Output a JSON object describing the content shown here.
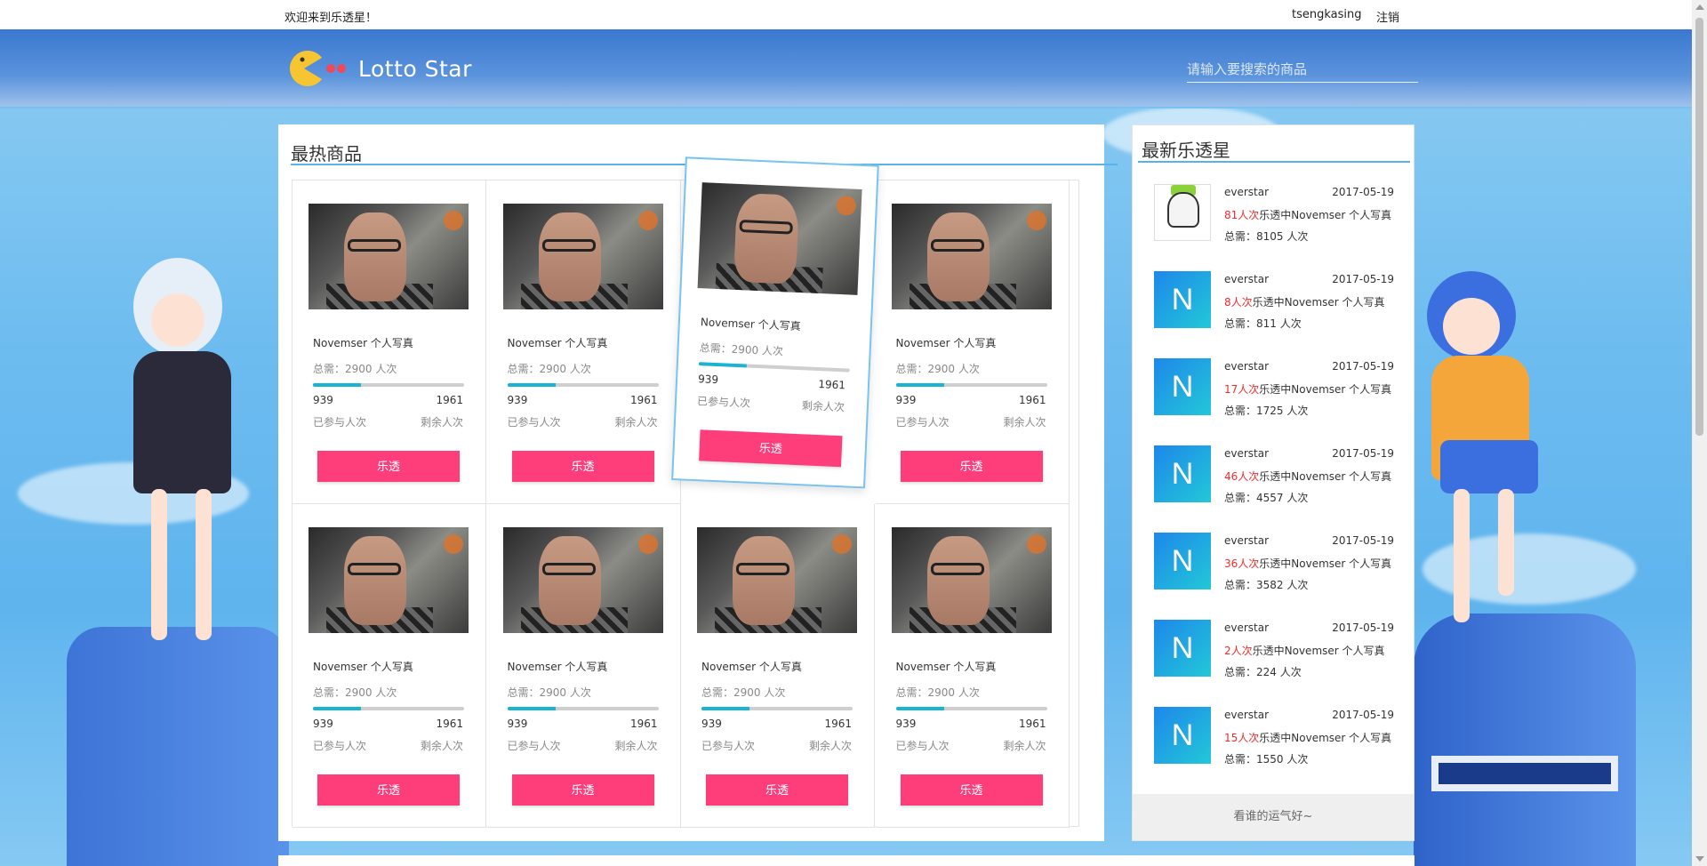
{
  "topbar": {
    "welcome": "欢迎来到乐透星！",
    "username": "tsengkasing",
    "logout": "注销"
  },
  "header": {
    "logo_text": "Lotto Star",
    "search_placeholder": "请输入要搜索的商品"
  },
  "hot": {
    "title": "最热商品",
    "products": [
      {
        "name": "Novemser 个人写真",
        "need": "总需：2900 人次",
        "joined": "939",
        "remain": "1961",
        "joined_label": "已参与人次",
        "remain_label": "剩余人次",
        "button": "乐透",
        "progress": 0.32
      },
      {
        "name": "Novemser 个人写真",
        "need": "总需：2900 人次",
        "joined": "939",
        "remain": "1961",
        "joined_label": "已参与人次",
        "remain_label": "剩余人次",
        "button": "乐透",
        "progress": 0.32
      },
      {
        "name": "Novemser 个人写真",
        "need": "总需：2900 人次",
        "joined": "939",
        "remain": "1961",
        "joined_label": "已参与人次",
        "remain_label": "剩余人次",
        "button": "乐透",
        "progress": 0.32
      },
      {
        "name": "Novemser 个人写真",
        "need": "总需：2900 人次",
        "joined": "939",
        "remain": "1961",
        "joined_label": "已参与人次",
        "remain_label": "剩余人次",
        "button": "乐透",
        "progress": 0.32
      },
      {
        "name": "Novemser 个人写真",
        "need": "总需：2900 人次",
        "joined": "939",
        "remain": "1961",
        "joined_label": "已参与人次",
        "remain_label": "剩余人次",
        "button": "乐透",
        "progress": 0.32
      },
      {
        "name": "Novemser 个人写真",
        "need": "总需：2900 人次",
        "joined": "939",
        "remain": "1961",
        "joined_label": "已参与人次",
        "remain_label": "剩余人次",
        "button": "乐透",
        "progress": 0.32
      },
      {
        "name": "Novemser 个人写真",
        "need": "总需：2900 人次",
        "joined": "939",
        "remain": "1961",
        "joined_label": "已参与人次",
        "remain_label": "剩余人次",
        "button": "乐透",
        "progress": 0.32
      },
      {
        "name": "Novemser 个人写真",
        "need": "总需：2900 人次",
        "joined": "939",
        "remain": "1961",
        "joined_label": "已参与人次",
        "remain_label": "剩余人次",
        "button": "乐透",
        "progress": 0.32
      }
    ]
  },
  "winners": {
    "title": "最新乐透星",
    "items": [
      {
        "avatar": "",
        "user": "everstar",
        "date": "2017-05-19",
        "count": "81人次",
        "info": "乐透中Novemser 个人写真",
        "total": "总需：8105 人次"
      },
      {
        "avatar": "N",
        "user": "everstar",
        "date": "2017-05-19",
        "count": "8人次",
        "info": "乐透中Novemser 个人写真",
        "total": "总需：811 人次"
      },
      {
        "avatar": "N",
        "user": "everstar",
        "date": "2017-05-19",
        "count": "17人次",
        "info": "乐透中Novemser 个人写真",
        "total": "总需：1725 人次"
      },
      {
        "avatar": "N",
        "user": "everstar",
        "date": "2017-05-19",
        "count": "46人次",
        "info": "乐透中Novemser 个人写真",
        "total": "总需：4557 人次"
      },
      {
        "avatar": "N",
        "user": "everstar",
        "date": "2017-05-19",
        "count": "36人次",
        "info": "乐透中Novemser 个人写真",
        "total": "总需：3582 人次"
      },
      {
        "avatar": "N",
        "user": "everstar",
        "date": "2017-05-19",
        "count": "2人次",
        "info": "乐透中Novemser 个人写真",
        "total": "总需：224 人次"
      },
      {
        "avatar": "N",
        "user": "everstar",
        "date": "2017-05-19",
        "count": "15人次",
        "info": "乐透中Novemser 个人写真",
        "total": "总需：1550 人次"
      }
    ],
    "footer": "看谁的运气好~"
  },
  "colors": {
    "accent": "#fe3e7a",
    "progress": "#18b4d3",
    "highlight": "#f02b2b",
    "title_line": "#5ab3e8"
  }
}
